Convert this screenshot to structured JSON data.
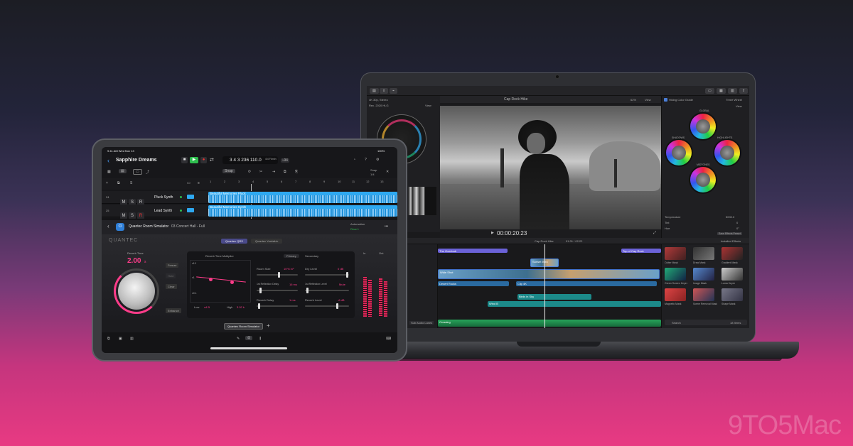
{
  "fcp": {
    "library": "4K 30p, Stereo",
    "rec": "Rec. 2020 HLG",
    "title": "Cap Rock Hike",
    "zoom": "62%",
    "view": "View",
    "timecode": "00:00:20:23",
    "timeline_name": "Cap Rock Hike",
    "timeline_time": "01:31 / 02:22",
    "inspector_title": "Hiking Color Grade",
    "inspector_time": "Three Wheel",
    "wheels": [
      "GLOBAL",
      "SHADOWS",
      "HIGHLIGHTS",
      "MIDTONES"
    ],
    "params": [
      {
        "k": "Temperature",
        "v": "5000.0"
      },
      {
        "k": "Tint",
        "v": "0"
      },
      {
        "k": "Hue",
        "v": "0°"
      }
    ],
    "save": "Save Effects Preset",
    "effects_title": "Installed Effects",
    "effects": [
      "Cutter Mask",
      "Draw Mask",
      "Gradient Mask",
      "Green Screen Keyer",
      "Image Mask",
      "Luma Keyer",
      "Magnetic Mask",
      "Scene Removal Mask",
      "Shape Mask"
    ],
    "search": "Search",
    "items": "18 Items",
    "clips": [
      "The Overlook",
      "Top of Cap Rock",
      "Chapter Fill Hike",
      "Sunset Intro",
      "Wide Shot",
      "Desert Rocks",
      "Clip 4K",
      "Sun Flare",
      "Sunset Drone",
      "Hike Ends",
      "Return Path",
      "Birds in Sky",
      "Wind B",
      "Crossing"
    ],
    "sidebar": "Sub Audio Lanes"
  },
  "lp": {
    "clock": "9:41 AM  Wed Nov 13",
    "battery": "100%",
    "project": "Sapphire Dreams",
    "lcd": "3 4 3 236  110.0",
    "sig": "4/4  F#min",
    "key": "♭94",
    "snap": "Snap",
    "snap_val": "1/4",
    "ruler": [
      "1",
      "2",
      "3",
      "4",
      "5",
      "6",
      "7",
      "8",
      "9",
      "10",
      "11",
      "12",
      "13"
    ],
    "tracks": [
      {
        "num": "24",
        "name": "Pluck Synth",
        "region": "Beautiful Memories Pluck"
      },
      {
        "num": "25",
        "name": "Lead Synth",
        "region": "Beautiful Memories Synth"
      }
    ],
    "plugin": "Quantec Room Simulator",
    "preset": "03 Concert Hall - Full",
    "automation": "Automation",
    "automation_val": "Read ↓",
    "more": "•••",
    "brand": "QUANTEC",
    "tabs": [
      "Quantec QRS",
      "Quantec Yardstick"
    ],
    "reverb_label": "Reverb Time",
    "reverb_val": "2.00",
    "reverb_unit": "s",
    "side_btns": [
      "Freeze",
      "Hold",
      "Clear",
      "Enhance"
    ],
    "graph_title": "Reverb Time Multiplier",
    "graph_labels": [
      "x10",
      "x1",
      "x0.1",
      "Low",
      "x4 B",
      "High",
      "3.02 k"
    ],
    "pills": [
      "Primary",
      "Secondary"
    ],
    "controls": [
      {
        "k": "Room Size",
        "v": "10^6 m³"
      },
      {
        "k": "Dry Level",
        "v": "0 dB"
      },
      {
        "k": "1st Reflection Delay",
        "v": "16 ms"
      },
      {
        "k": "1st Reflection Level",
        "v": "Mute"
      },
      {
        "k": "Reverb Delay",
        "v": "1 ms"
      },
      {
        "k": "Reverb Level",
        "v": "-6 dB"
      }
    ],
    "meter_labels": [
      "In",
      "Out"
    ],
    "bottom_plugin": "Quantec Room Simulator",
    "add": "+"
  },
  "watermark": "9TO5Mac"
}
